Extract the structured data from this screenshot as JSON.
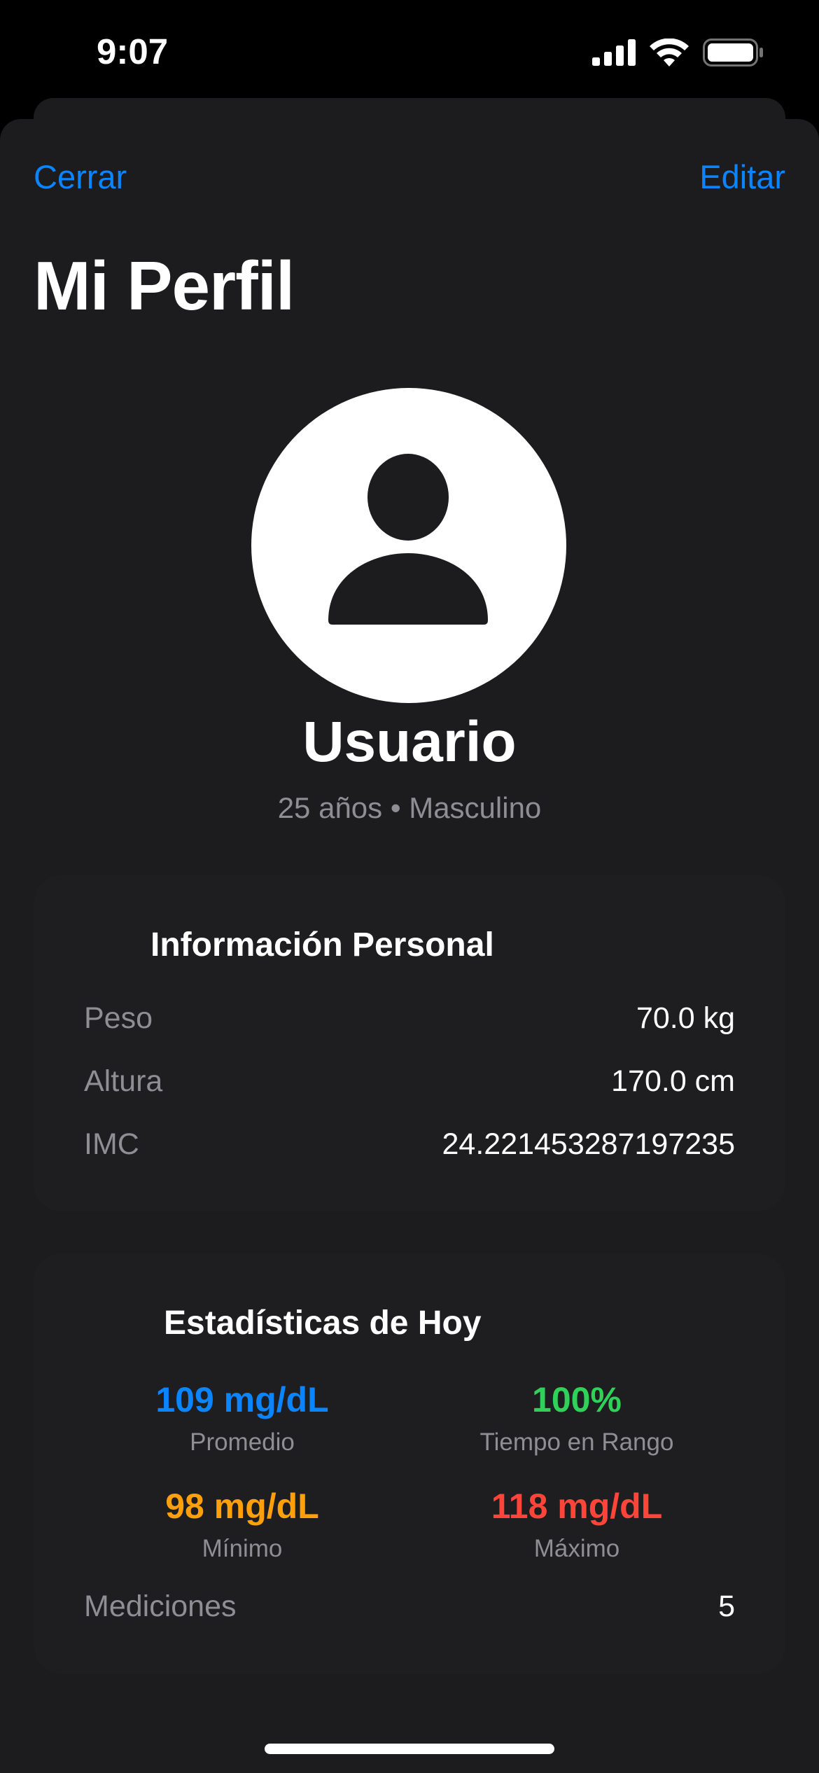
{
  "status_bar": {
    "time": "9:07",
    "icons": [
      "cellular-signal-icon",
      "wifi-icon",
      "battery-icon"
    ]
  },
  "nav": {
    "close_label": "Cerrar",
    "edit_label": "Editar"
  },
  "page_title": "Mi Perfil",
  "profile": {
    "avatar_icon": "person-icon",
    "name": "Usuario",
    "meta": "25 años • Masculino"
  },
  "personal_info": {
    "title": "Información Personal",
    "rows": [
      {
        "label": "Peso",
        "value": "70.0 kg"
      },
      {
        "label": "Altura",
        "value": "170.0 cm"
      },
      {
        "label": "IMC",
        "value": "24.221453287197235"
      }
    ]
  },
  "stats": {
    "title": "Estadísticas de Hoy",
    "average": {
      "value": "109 mg/dL",
      "label": "Promedio",
      "color": "#0a84ff"
    },
    "time_in_range": {
      "value": "100%",
      "label": "Tiempo en Rango",
      "color": "#30d158"
    },
    "minimum": {
      "value": "98 mg/dL",
      "label": "Mínimo",
      "color": "#ff9f0a"
    },
    "maximum": {
      "value": "118 mg/dL",
      "label": "Máximo",
      "color": "#ff453a"
    },
    "measurements": {
      "label": "Mediciones",
      "value": "5"
    }
  },
  "colors": {
    "accent": "#0a84ff",
    "background": "#1c1c1e"
  }
}
